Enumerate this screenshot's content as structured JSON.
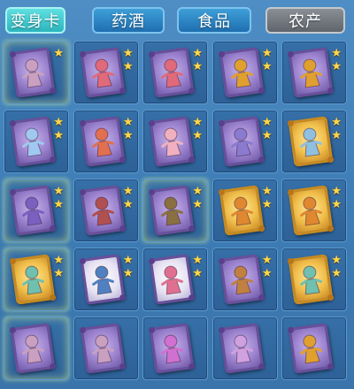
{
  "tabs": [
    {
      "label": "变身卡",
      "active": true
    },
    {
      "label": "药酒",
      "active": false
    },
    {
      "label": "食品",
      "active": false
    },
    {
      "label": "农产",
      "active": false
    }
  ],
  "colors": {
    "accent": "#2cb5bd",
    "inactive": "#1f6fb0",
    "star": "#ffd84a"
  },
  "inventory": {
    "slots": [
      {
        "icon": "transformation-card-icon",
        "frame": "purple",
        "stars": 1,
        "glow": true,
        "figure": "#c9a0c0"
      },
      {
        "icon": "transformation-card-icon",
        "frame": "purple",
        "stars": 2,
        "glow": false,
        "figure": "#e06a7a"
      },
      {
        "icon": "transformation-card-icon",
        "frame": "purple",
        "stars": 2,
        "glow": false,
        "figure": "#e06a7a"
      },
      {
        "icon": "transformation-card-icon",
        "frame": "purple",
        "stars": 2,
        "glow": false,
        "figure": "#e0a030"
      },
      {
        "icon": "transformation-card-icon",
        "frame": "purple",
        "stars": 2,
        "glow": false,
        "figure": "#e0a030"
      },
      {
        "icon": "transformation-card-icon",
        "frame": "purple",
        "stars": 2,
        "glow": false,
        "figure": "#a0c8f0"
      },
      {
        "icon": "transformation-card-icon",
        "frame": "purple",
        "stars": 2,
        "glow": false,
        "figure": "#e07050"
      },
      {
        "icon": "transformation-card-icon",
        "frame": "purple",
        "stars": 2,
        "glow": false,
        "figure": "#f0b0c0"
      },
      {
        "icon": "transformation-card-icon",
        "frame": "purple",
        "stars": 2,
        "glow": false,
        "figure": "#8a7ad0"
      },
      {
        "icon": "transformation-card-icon",
        "frame": "gold",
        "stars": 2,
        "glow": false,
        "figure": "#8fc0e0"
      },
      {
        "icon": "transformation-card-icon",
        "frame": "purple",
        "stars": 2,
        "glow": true,
        "figure": "#7a60c0"
      },
      {
        "icon": "transformation-card-icon",
        "frame": "purple",
        "stars": 2,
        "glow": false,
        "figure": "#b05050"
      },
      {
        "icon": "transformation-card-icon",
        "frame": "purple",
        "stars": 2,
        "glow": true,
        "figure": "#8a7040"
      },
      {
        "icon": "transformation-card-icon",
        "frame": "gold",
        "stars": 2,
        "glow": false,
        "figure": "#e08830"
      },
      {
        "icon": "transformation-card-icon",
        "frame": "gold",
        "stars": 2,
        "glow": false,
        "figure": "#e08830"
      },
      {
        "icon": "transformation-card-icon",
        "frame": "gold",
        "stars": 2,
        "glow": true,
        "figure": "#70c0b0"
      },
      {
        "icon": "transformation-card-icon",
        "frame": "white",
        "stars": 2,
        "glow": false,
        "figure": "#5080c0"
      },
      {
        "icon": "transformation-card-icon",
        "frame": "white",
        "stars": 2,
        "glow": false,
        "figure": "#e07090"
      },
      {
        "icon": "transformation-card-icon",
        "frame": "purple",
        "stars": 2,
        "glow": false,
        "figure": "#c08040"
      },
      {
        "icon": "transformation-card-icon",
        "frame": "gold",
        "stars": 2,
        "glow": false,
        "figure": "#70c0b0"
      },
      {
        "icon": "transformation-card-icon",
        "frame": "purple",
        "stars": 0,
        "glow": true,
        "figure": "#c9a0c0"
      },
      {
        "icon": "transformation-card-icon",
        "frame": "purple",
        "stars": 0,
        "glow": false,
        "figure": "#c9a0c0"
      },
      {
        "icon": "transformation-card-icon",
        "frame": "purple",
        "stars": 0,
        "glow": false,
        "figure": "#d070d0"
      },
      {
        "icon": "transformation-card-icon",
        "frame": "purple",
        "stars": 0,
        "glow": false,
        "figure": "#d0a0e0"
      },
      {
        "icon": "transformation-card-icon",
        "frame": "purple",
        "stars": 0,
        "glow": false,
        "figure": "#e0a030"
      }
    ]
  }
}
